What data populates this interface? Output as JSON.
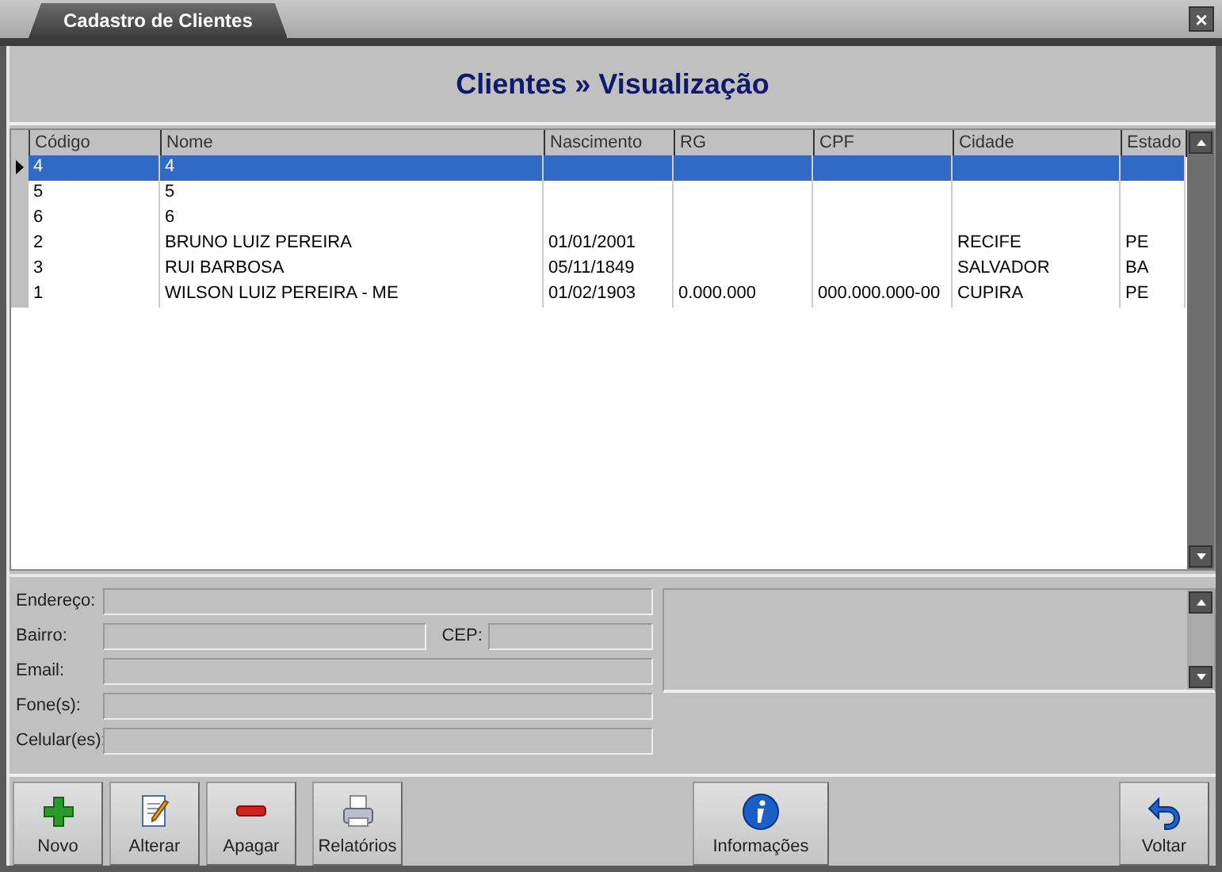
{
  "window": {
    "tab": "Cadastro de Clientes",
    "close": "×"
  },
  "header": {
    "title": "Clientes » Visualização"
  },
  "table": {
    "columns": [
      "Código",
      "Nome",
      "Nascimento",
      "RG",
      "CPF",
      "Cidade",
      "Estado"
    ],
    "rows": [
      {
        "selected": true,
        "cells": [
          "4",
          "4",
          "",
          "",
          "",
          "",
          ""
        ]
      },
      {
        "selected": false,
        "cells": [
          "5",
          "5",
          "",
          "",
          "",
          "",
          ""
        ]
      },
      {
        "selected": false,
        "cells": [
          "6",
          "6",
          "",
          "",
          "",
          "",
          ""
        ]
      },
      {
        "selected": false,
        "cells": [
          "2",
          "BRUNO LUIZ PEREIRA",
          "01/01/2001",
          "",
          "",
          "RECIFE",
          "PE"
        ]
      },
      {
        "selected": false,
        "cells": [
          "3",
          "RUI BARBOSA",
          "05/11/1849",
          "",
          "",
          "SALVADOR",
          "BA"
        ]
      },
      {
        "selected": false,
        "cells": [
          "1",
          "WILSON LUIZ PEREIRA - ME",
          "01/02/1903",
          "0.000.000",
          "000.000.000-00",
          "CUPIRA",
          "PE"
        ]
      }
    ]
  },
  "details": [
    {
      "label": "Endereço:"
    },
    {
      "label": "Bairro:",
      "extra_label": "CEP:"
    },
    {
      "label": "Email:"
    },
    {
      "label": "Fone(s):"
    },
    {
      "label": "Celular(es):"
    }
  ],
  "toolbar": [
    {
      "label": "Novo",
      "kind": "add"
    },
    {
      "label": "Alterar",
      "kind": "edit"
    },
    {
      "label": "Apagar",
      "kind": "delete"
    },
    {
      "label": "Relatórios",
      "kind": "report"
    },
    {
      "label": "Informações",
      "kind": "info"
    },
    {
      "label": "Voltar",
      "kind": "back"
    }
  ]
}
